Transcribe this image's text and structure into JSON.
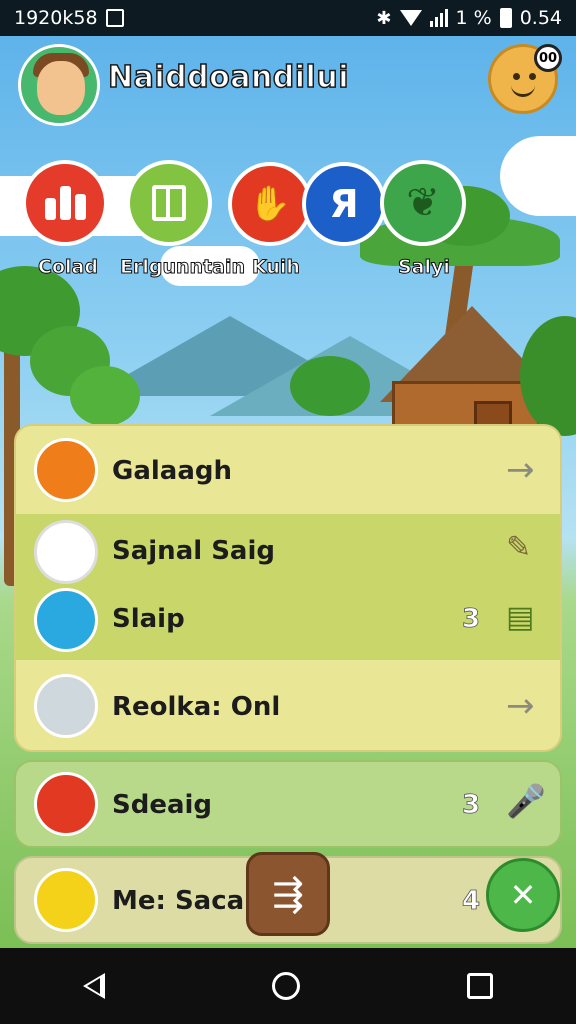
{
  "status_bar": {
    "time_left": "1920k58",
    "battery_text": "1 %",
    "time_right": "0.54"
  },
  "header": {
    "title": "Naiddoandilui",
    "notification_badge": "00"
  },
  "categories": [
    {
      "label": "Colad",
      "color": "#e53b2a",
      "icon": "bar-chart-icon"
    },
    {
      "label": "Erlgunntain",
      "color": "#82c341",
      "icon": "book-icon"
    },
    {
      "label": "Kuih",
      "color": "#e23a22",
      "icon": "hand-icon"
    },
    {
      "label": "",
      "color": "#1d5fc9",
      "icon": "letter-icon"
    },
    {
      "label": "Salyi",
      "color": "#3da64a",
      "icon": "leaf-icon"
    }
  ],
  "rows": [
    {
      "label": "Galaagh",
      "icon": "bird-icon",
      "icon_color": "#ef7d1a",
      "count": "",
      "action": "arrow-right-icon"
    },
    {
      "label": "Sajnal Saig",
      "icon": "cat-avatar-icon",
      "icon_color": "#ffffff",
      "count": "",
      "action": "pencil-icon"
    },
    {
      "label": "Slaip",
      "icon": "chat-bubble-icon",
      "icon_color": "#2aa8e0",
      "count": "3",
      "action": "list-icon"
    },
    {
      "label": "Reolka: Onl",
      "icon": "girl-avatar-icon",
      "icon_color": "#cfd8dc",
      "count": "",
      "action": "arrow-right-icon"
    },
    {
      "label": "Sdeaig",
      "icon": "fox-icon",
      "icon_color": "#e23a22",
      "count": "3",
      "action": "microphone-icon"
    },
    {
      "label": "Me: Sacam",
      "icon": "rocket-icon",
      "icon_color": "#f5d21a",
      "count": "4",
      "action": "close-icon"
    }
  ],
  "colors": {
    "accent_green": "#4db849",
    "card_yellow": "#e9e696",
    "card_green": "#b9d98a"
  }
}
